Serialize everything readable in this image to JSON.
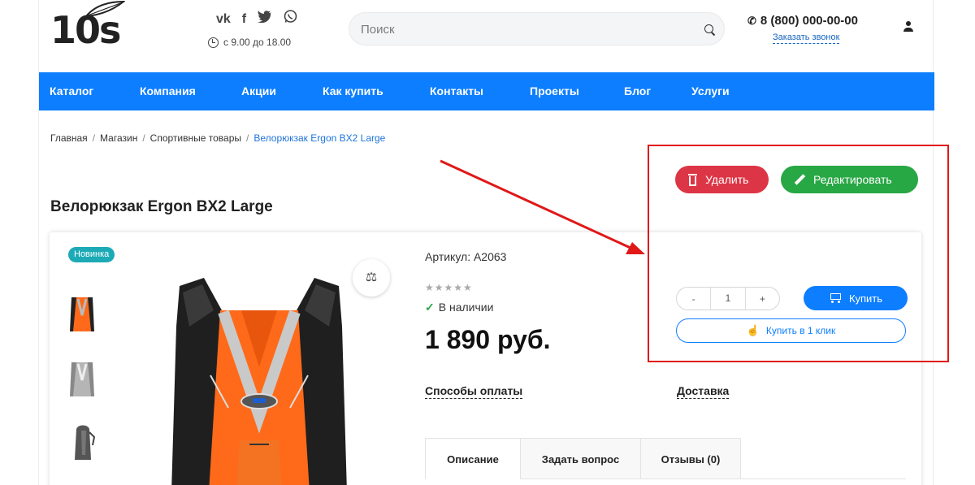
{
  "header": {
    "logo_text": "10s",
    "social_icons": [
      "vk-icon",
      "facebook-icon",
      "twitter-icon",
      "whatsapp-icon"
    ],
    "hours": "с 9.00 до 18.00",
    "search_placeholder": "Поиск",
    "phone": "8 (800) 000-00-00",
    "callback_label": "Заказать звонок"
  },
  "nav": {
    "items": [
      "Каталог",
      "Компания",
      "Акции",
      "Как купить",
      "Контакты",
      "Проекты",
      "Блог",
      "Услуги"
    ]
  },
  "breadcrumb": {
    "items": [
      "Главная",
      "Магазин",
      "Спортивные товары"
    ],
    "current": "Велорюкзак Ergon BX2 Large"
  },
  "actions": {
    "delete_label": "Удалить",
    "edit_label": "Редактировать"
  },
  "product": {
    "title": "Велорюкзак Ergon BX2 Large",
    "badge": "Новинка",
    "sku": "Артикул: A2063",
    "rating": 0,
    "stock": "В наличии",
    "price": "1 890 руб.",
    "payment_link": "Способы оплаты",
    "delivery_link": "Доставка",
    "qty_minus": "-",
    "qty_value": "1",
    "qty_plus": "+",
    "buy_label": "Купить",
    "oneclick_label": "Купить в 1 клик"
  },
  "tabs": [
    "Описание",
    "Задать вопрос",
    "Отзывы (0)"
  ],
  "colors": {
    "primary": "#0d7eff",
    "delete": "#dc3545",
    "edit": "#28a745",
    "badge": "#1caab6",
    "annotation": "#e01818"
  }
}
